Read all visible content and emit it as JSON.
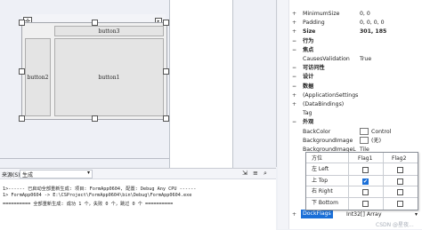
{
  "designer": {
    "button3_label": "button3",
    "button2_label": "button2",
    "button1_label": "button1"
  },
  "output": {
    "from_label": "来源(S):",
    "from_value": "生成",
    "lines": [
      "1>------ 已启动全部重新生成: 项目: FormApp0604, 配置: Debug Any CPU ------",
      "1>  FormApp0604 -> E:\\CSProject\\FormApp0604\\bin\\Debug\\FormApp0604.exe",
      "========== 全部重新生成: 成功 1 个，失败 0 个，跳过 0 个 =========="
    ]
  },
  "properties": {
    "rows": [
      {
        "name": "MinimumSize",
        "value": "0, 0",
        "toggle": "+"
      },
      {
        "name": "Padding",
        "value": "0, 0, 0, 0",
        "toggle": "+"
      },
      {
        "name": "Size",
        "value": "301, 185",
        "toggle": "+",
        "bold": true
      },
      {
        "name": "行为",
        "value": "",
        "toggle": "−",
        "cat": true
      },
      {
        "name": "焦点",
        "value": "",
        "toggle": "−",
        "cat": true
      },
      {
        "name": "CausesValidation",
        "value": "True",
        "toggle": ""
      },
      {
        "name": "可访问性",
        "value": "",
        "toggle": "−",
        "cat": true
      },
      {
        "name": "设计",
        "value": "",
        "toggle": "−",
        "cat": true
      },
      {
        "name": "数据",
        "value": "",
        "toggle": "−",
        "cat": true
      },
      {
        "name": "(ApplicationSettings",
        "value": "",
        "toggle": "+"
      },
      {
        "name": "(DataBindings)",
        "value": "",
        "toggle": "+"
      },
      {
        "name": "Tag",
        "value": "",
        "toggle": ""
      },
      {
        "name": "外观",
        "value": "",
        "toggle": "−",
        "cat": true
      },
      {
        "name": "BackColor",
        "value": "Control",
        "toggle": "",
        "swatch": true
      },
      {
        "name": "BackgroundImage",
        "value": "(无)",
        "toggle": "",
        "swatch": true
      },
      {
        "name": "BackgroundImageL",
        "value": "Tile",
        "toggle": ""
      }
    ],
    "dockflags_name": "DockFlags",
    "dockflags_value": "Int32[] Array"
  },
  "dock_dropdown": {
    "headers": [
      "方位",
      "Flag1",
      "Flag2"
    ],
    "rows": [
      {
        "label": "左 Left",
        "flag1": false,
        "flag2": false
      },
      {
        "label": "上 Top",
        "flag1": true,
        "flag2": false
      },
      {
        "label": "右 Right",
        "flag1": false,
        "flag2": false
      },
      {
        "label": "下 Bottom",
        "flag1": false,
        "flag2": false
      }
    ]
  },
  "watermark": "CSDN @星夜..."
}
